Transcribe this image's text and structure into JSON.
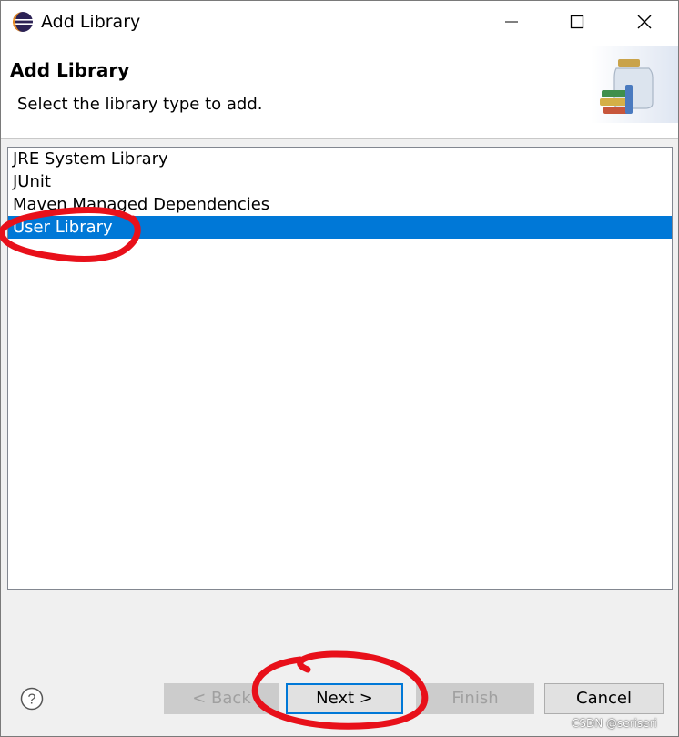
{
  "window": {
    "title": "Add Library",
    "app_icon": "eclipse-icon",
    "controls": [
      "minimize-icon",
      "maximize-icon",
      "close-icon"
    ]
  },
  "banner": {
    "title": "Add Library",
    "description": "Select the library type to add.",
    "icon": "library-jar-icon"
  },
  "library_types": [
    {
      "label": "JRE System Library",
      "selected": false
    },
    {
      "label": "JUnit",
      "selected": false
    },
    {
      "label": "Maven Managed Dependencies",
      "selected": false
    },
    {
      "label": "User Library",
      "selected": true
    }
  ],
  "footer": {
    "help_icon": "help-icon",
    "back_label": "< Back",
    "next_label": "Next >",
    "finish_label": "Finish",
    "cancel_label": "Cancel"
  },
  "annotation": {
    "color": "#e8101a"
  },
  "colors": {
    "selection": "#0078d7"
  },
  "watermark": "CSDN @seriseri"
}
